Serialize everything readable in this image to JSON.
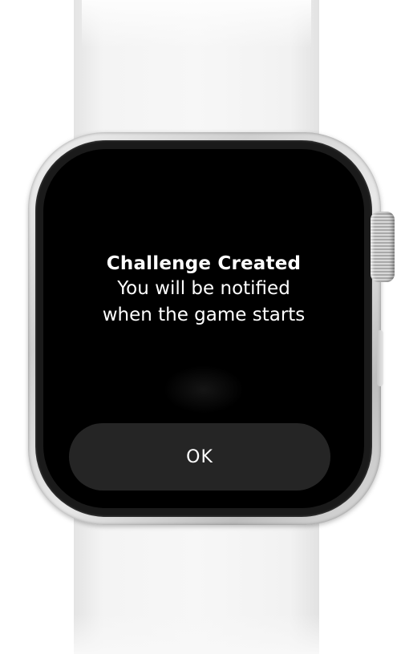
{
  "alert": {
    "title": "Challenge Created",
    "body_line_1": "You will be notified",
    "body_line_2": "when the game starts",
    "ok_label": "OK"
  },
  "device": {
    "case_color": "#d4d4d4",
    "band_color": "#f5f5f5",
    "screen_color": "#000000",
    "button_color": "#252525"
  }
}
